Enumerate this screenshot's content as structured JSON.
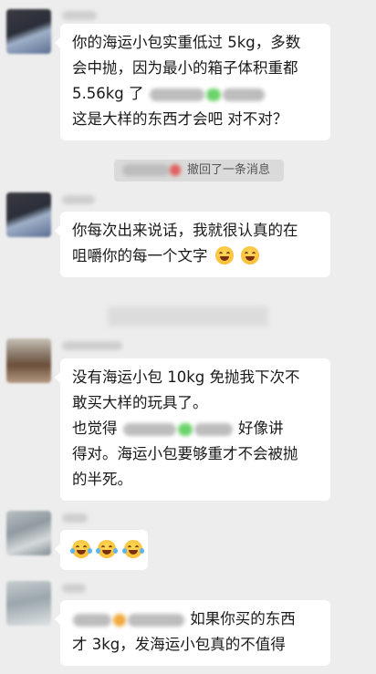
{
  "messages": [
    {
      "lines": [
        "你的海运小包实重低过 5kg，多数",
        "会中抛，因为最小的箱子体积重都",
        "5.56kg 了",
        "这是大样的东西才会吧 对不对？"
      ]
    },
    {
      "lines": [
        "你每次出来说话，我就很认真的在",
        "咀嚼你的每一个文字"
      ],
      "emoji": "grinning-sweat-face-icon"
    },
    {
      "lines": [
        "没有海运小包 10kg 免抛我下次不",
        "敢买大样的玩具了。",
        "也觉得",
        "好像讲",
        "得对。海运小包要够重才不会被抛",
        "的半死。"
      ]
    },
    {
      "emoji": "face-with-tears-of-joy-icon"
    },
    {
      "lines": [
        "如果你买的东西",
        "才 3kg，发海运小包真的不值得"
      ]
    }
  ],
  "system_notice": "撤回了一条消息",
  "colors": {
    "background": "#ededed",
    "bubble": "#ffffff",
    "text": "#191919"
  }
}
